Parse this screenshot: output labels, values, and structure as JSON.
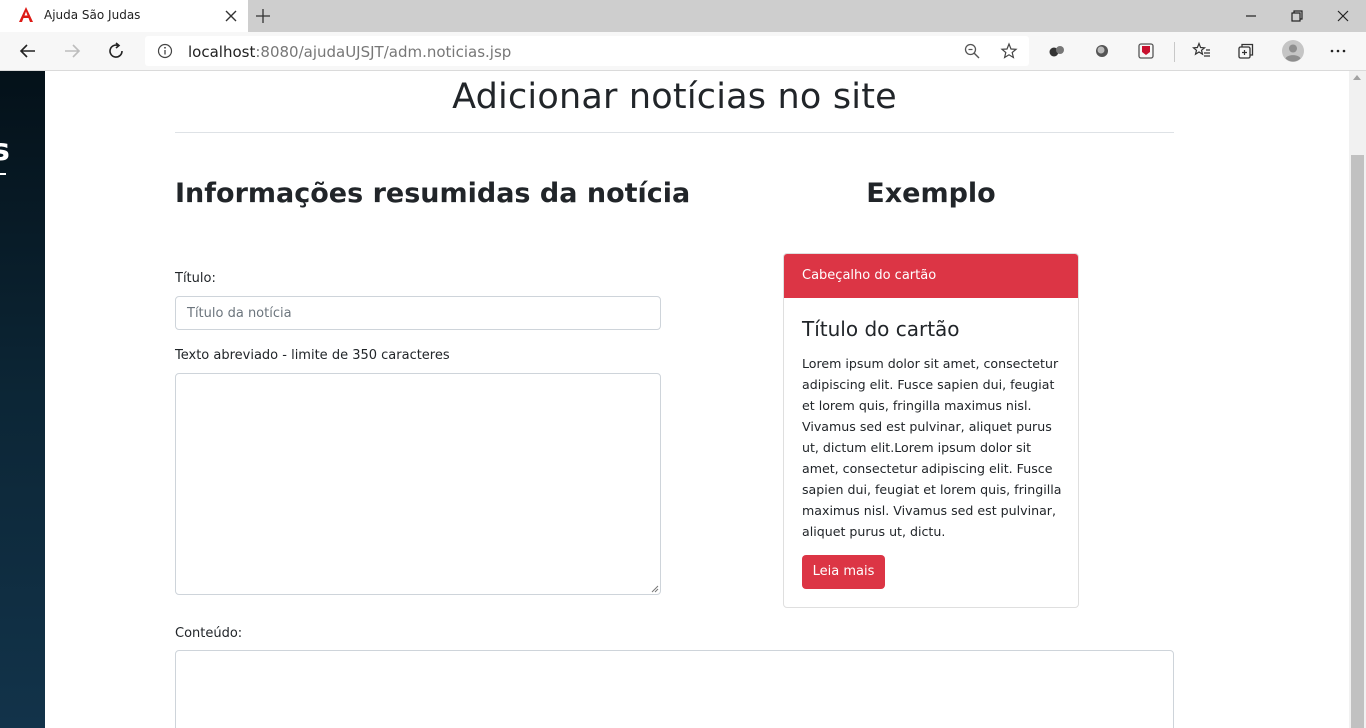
{
  "browser": {
    "tab_title": "Ajuda São Judas",
    "url_host": "localhost",
    "url_path": ":8080/ajudaUJSJT/adm.noticias.jsp"
  },
  "page": {
    "title": "Adicionar notícias no site",
    "section_title": "Informações resumidas da notícia",
    "example_title": "Exemplo",
    "form": {
      "title_label": "Título:",
      "title_placeholder": "Título da notícia",
      "summary_label": "Texto abreviado - limite de 350 caracteres",
      "content_label": "Conteúdo:"
    },
    "card": {
      "header": "Cabeçalho do cartão",
      "title": "Título do cartão",
      "text": "Lorem ipsum dolor sit amet, consectetur adipiscing elit. Fusce sapien dui, feugiat et lorem quis, fringilla maximus nisl. Vivamus sed est pulvinar, aliquet purus ut, dictum elit.Lorem ipsum dolor sit amet, consectetur adipiscing elit. Fusce sapien dui, feugiat et lorem quis, fringilla maximus nisl. Vivamus sed est pulvinar, aliquet purus ut, dictu.",
      "button": "Leia mais"
    }
  },
  "colors": {
    "accent": "#dc3545",
    "sidebar": "#0c2636"
  },
  "icons": [
    "angular-logo-icon",
    "close-icon",
    "plus-icon",
    "minimize-icon",
    "maximize-icon",
    "back-icon",
    "forward-icon",
    "refresh-icon",
    "info-icon",
    "zoom-icon",
    "star-icon",
    "extension-icon",
    "favorites-icon",
    "collections-icon",
    "profile-icon",
    "more-icon"
  ]
}
